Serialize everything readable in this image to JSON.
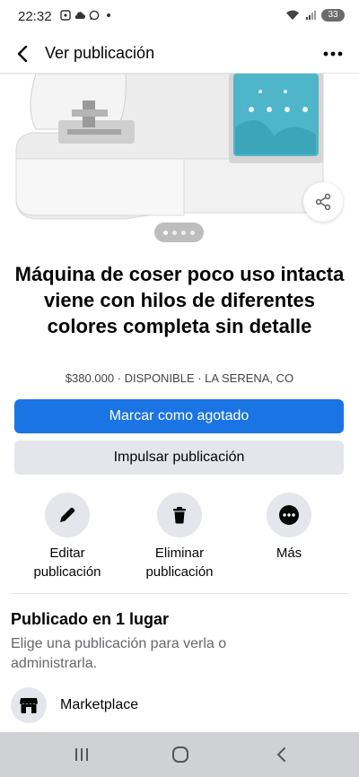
{
  "status_bar": {
    "time": "22:32",
    "battery": "33"
  },
  "header": {
    "title": "Ver publicación"
  },
  "listing": {
    "title": "Máquina de coser poco uso intacta viene con hilos de diferentes  colores completa sin detalle",
    "meta": "$380.000 · DISPONIBLE · LA SERENA, CO",
    "photo_count": 4,
    "active_photo": 1
  },
  "buttons": {
    "mark_sold": "Marcar como agotado",
    "boost": "Impulsar publicación"
  },
  "actions": {
    "edit": "Editar\npublicación",
    "delete": "Eliminar\npublicación",
    "more": "Más"
  },
  "published": {
    "title": "Publicado en 1 lugar",
    "subtitle": "Elige una publicación para verla o administrarla.",
    "places": [
      "Marketplace"
    ]
  },
  "colors": {
    "primary": "#1b74e4",
    "secondary_bg": "#e4e6eb"
  }
}
